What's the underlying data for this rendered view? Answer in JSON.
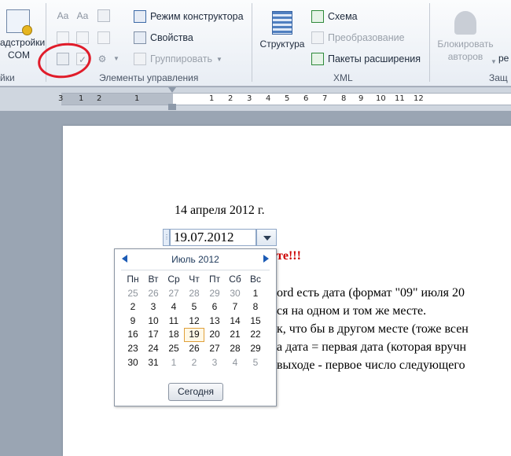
{
  "ribbon": {
    "addins": {
      "label_line1": "адстройки",
      "label_line2": "COM",
      "group": "йки"
    },
    "controls": {
      "group": "Элементы управления",
      "design_mode": "Режим конструктора",
      "properties": "Свойства",
      "group_btn": "Группировать"
    },
    "xml": {
      "group": "XML",
      "structure": "Структура",
      "schema": "Схема",
      "transform": "Преобразование",
      "packs": "Пакеты расширения"
    },
    "protect": {
      "block_line1": "Блокировать",
      "block_line2": "авторов",
      "restrict": "ре",
      "group": "Защ"
    }
  },
  "ruler": {
    "ticks": [
      "3",
      "1",
      "2",
      "1",
      "1",
      "2",
      "3",
      "4",
      "5",
      "6",
      "7",
      "8",
      "9",
      "10",
      "11",
      "12"
    ]
  },
  "document": {
    "line1": "14 апреля 2012 г.",
    "date_value": "19.07.2012",
    "red_text": "те!!!",
    "line3": "ord есть дата (формат \"09\" июля 20",
    "line4": "ся на одном и том же месте.",
    "line5": "к, что бы в другом месте (тоже всен",
    "line6": "а дата = первая дата (которая вручн",
    "line7": "выходе - первое число следующего"
  },
  "calendar": {
    "month": "Июль 2012",
    "weekdays": [
      "Пн",
      "Вт",
      "Ср",
      "Чт",
      "Пт",
      "Сб",
      "Вс"
    ],
    "weeks": [
      [
        "25",
        "26",
        "27",
        "28",
        "29",
        "30",
        "1"
      ],
      [
        "2",
        "3",
        "4",
        "5",
        "6",
        "7",
        "8"
      ],
      [
        "9",
        "10",
        "11",
        "12",
        "13",
        "14",
        "15"
      ],
      [
        "16",
        "17",
        "18",
        "19",
        "20",
        "21",
        "22"
      ],
      [
        "23",
        "24",
        "25",
        "26",
        "27",
        "28",
        "29"
      ],
      [
        "30",
        "31",
        "1",
        "2",
        "3",
        "4",
        "5"
      ]
    ],
    "other_month": [
      [
        0,
        0
      ],
      [
        0,
        1
      ],
      [
        0,
        2
      ],
      [
        0,
        3
      ],
      [
        0,
        4
      ],
      [
        0,
        5
      ],
      [
        5,
        2
      ],
      [
        5,
        3
      ],
      [
        5,
        4
      ],
      [
        5,
        5
      ],
      [
        5,
        6
      ]
    ],
    "selected": [
      3,
      3
    ],
    "today_button": "Сегодня"
  }
}
